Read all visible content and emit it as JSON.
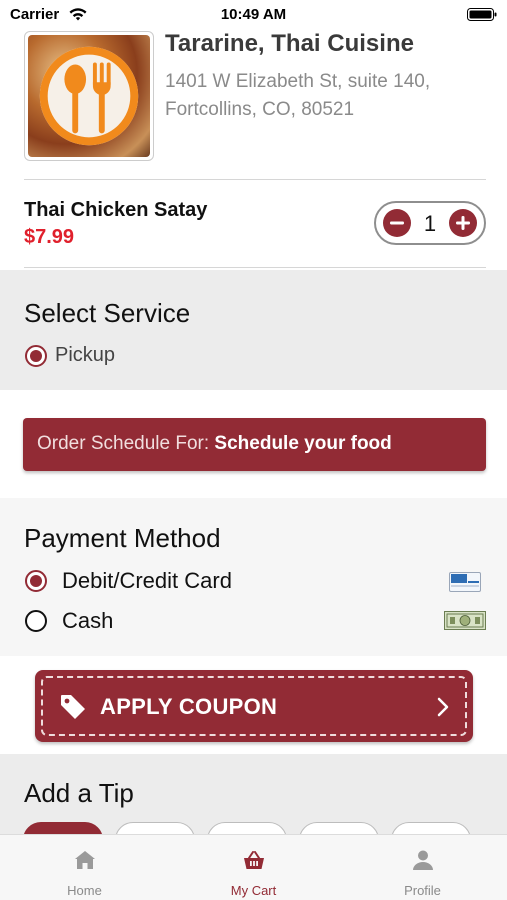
{
  "status_bar": {
    "carrier": "Carrier",
    "time": "10:49 AM"
  },
  "restaurant": {
    "name": "Tararine, Thai Cuisine",
    "address": "1401 W Elizabeth St, suite 140, Fortcollins, CO, 80521",
    "logo_icon": "fork-spoon-icon"
  },
  "cart_item": {
    "name": "Thai Chicken Satay",
    "price": "$7.99",
    "quantity": "1"
  },
  "service": {
    "title": "Select Service",
    "options": [
      {
        "label": "Pickup",
        "selected": true
      }
    ]
  },
  "schedule": {
    "prefix": "Order Schedule For: ",
    "value": "Schedule your food"
  },
  "payment": {
    "title": "Payment Method",
    "options": [
      {
        "label": "Debit/Credit Card",
        "selected": true,
        "icon": "credit-card-icon"
      },
      {
        "label": "Cash",
        "selected": false,
        "icon": "cash-icon"
      }
    ]
  },
  "coupon": {
    "label": "APPLY COUPON",
    "icon": "tag-icon"
  },
  "tip": {
    "title": "Add a Tip"
  },
  "tab_bar": {
    "items": [
      {
        "label": "Home",
        "icon": "home-icon",
        "active": false
      },
      {
        "label": "My Cart",
        "icon": "basket-icon",
        "active": true
      },
      {
        "label": "Profile",
        "icon": "person-icon",
        "active": false
      }
    ]
  },
  "colors": {
    "accent": "#922b35",
    "price": "#e0202c",
    "section_bg": "#ececec"
  }
}
